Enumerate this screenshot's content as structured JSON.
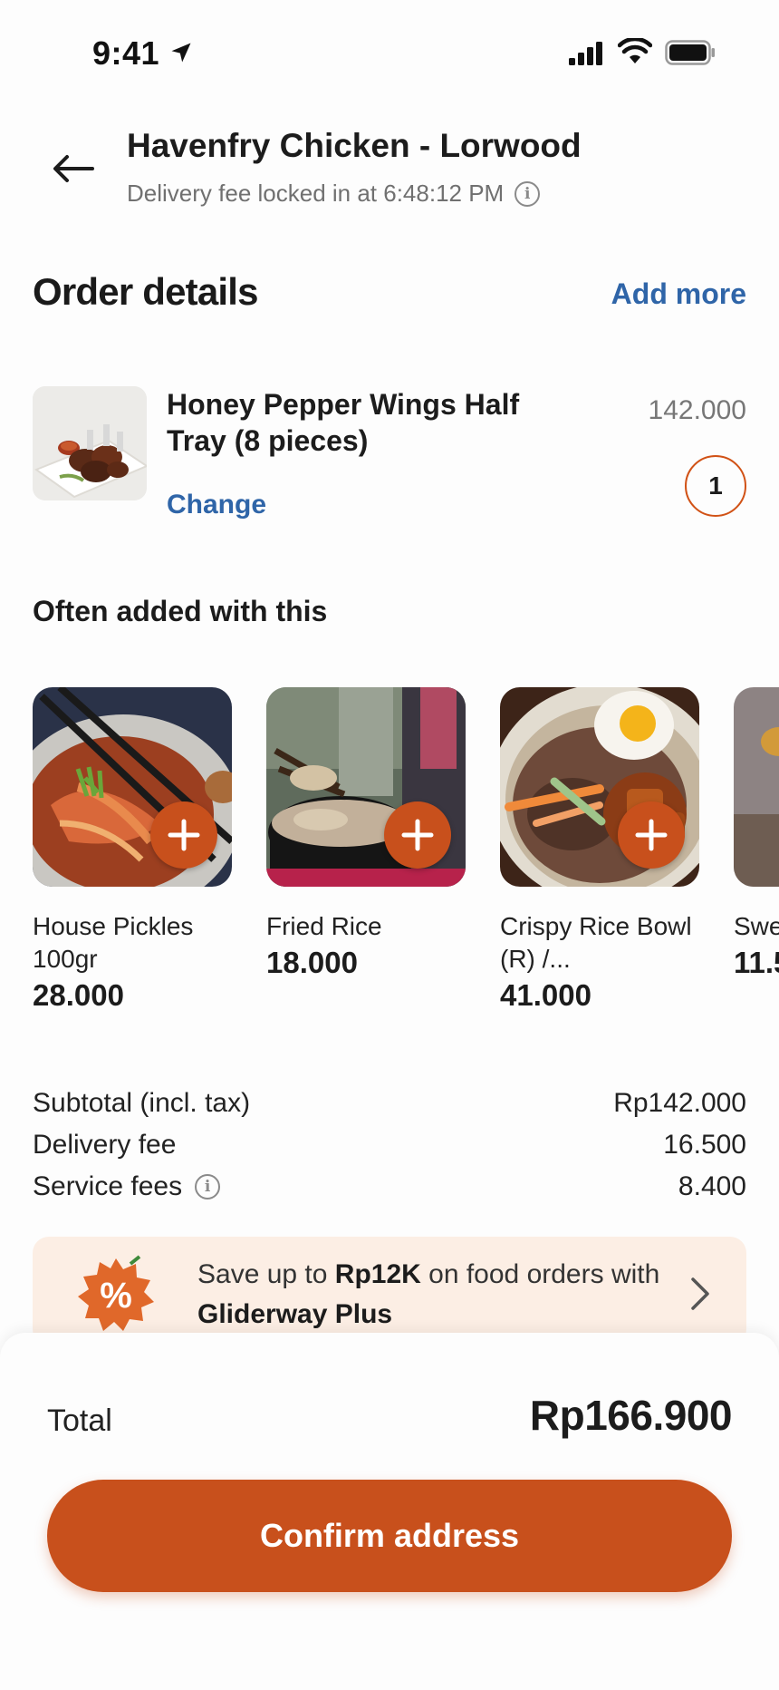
{
  "status_bar": {
    "time": "9:41"
  },
  "header": {
    "title": "Havenfry Chicken - Lorwood",
    "subtitle": "Delivery fee locked in at 6:48:12 PM"
  },
  "order": {
    "section_title": "Order details",
    "add_more_label": "Add more",
    "item": {
      "name": "Honey Pepper Wings Half Tray (8 pieces)",
      "change_label": "Change",
      "price": "142.000",
      "quantity": "1"
    }
  },
  "recommendations": {
    "title": "Often added with this",
    "items": [
      {
        "name": "House Pickles 100gr",
        "price": "28.000"
      },
      {
        "name": "Fried Rice",
        "price": "18.000"
      },
      {
        "name": "Crispy Rice Bowl (R) /...",
        "price": "41.000"
      },
      {
        "name": "Swe",
        "price": "11.5"
      }
    ]
  },
  "summary": {
    "subtotal_label": "Subtotal (incl. tax)",
    "subtotal_value": "Rp142.000",
    "delivery_label": "Delivery fee",
    "delivery_value": "16.500",
    "service_label": "Service fees",
    "service_value": "8.400"
  },
  "promo": {
    "text_prefix": "Save up to ",
    "text_bold_1": "Rp12K",
    "text_middle": " on food orders with ",
    "text_bold_2": "Gliderway Plus"
  },
  "footer": {
    "total_label": "Total",
    "total_value": "Rp166.900",
    "confirm_label": "Confirm address"
  },
  "colors": {
    "accent": "#c8501c",
    "link": "#2f65a8",
    "promo_bg": "#fceee4"
  }
}
